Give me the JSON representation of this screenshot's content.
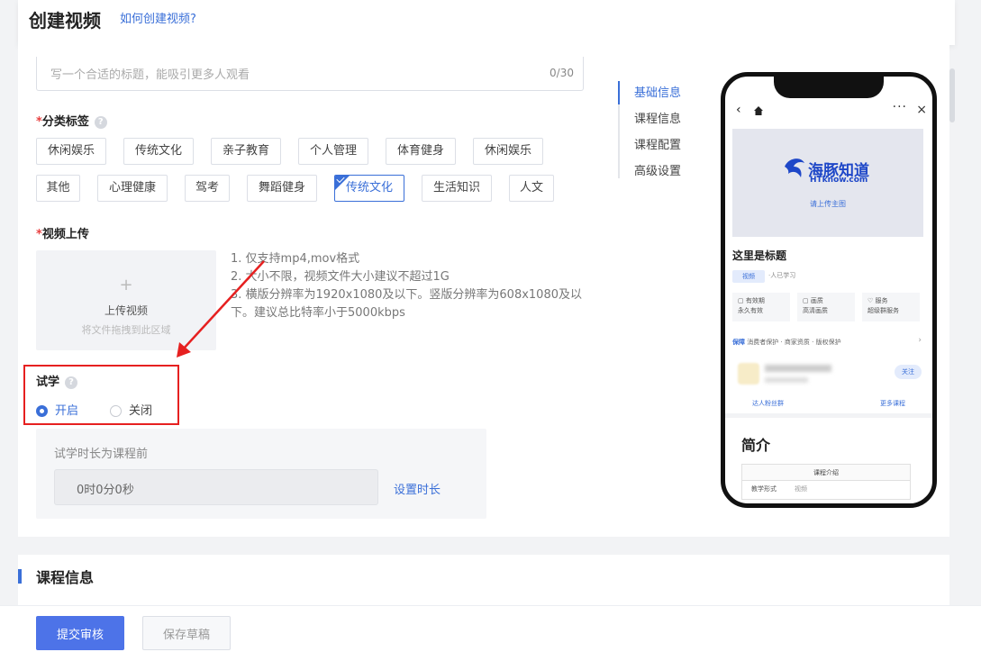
{
  "header": {
    "title": "创建视频",
    "help_link": "如何创建视频?"
  },
  "title_field": {
    "placeholder": "写一个合适的标题，能吸引更多人观看",
    "counter": "0/30"
  },
  "category": {
    "label": "分类标签",
    "required_mark": "*",
    "tags": [
      "休闲娱乐",
      "传统文化",
      "亲子教育",
      "个人管理",
      "体育健身",
      "休闲娱乐",
      "其他",
      "心理健康",
      "驾考",
      "舞蹈健身",
      "传统文化",
      "生活知识",
      "人文"
    ],
    "selected_index": 10
  },
  "video_upload": {
    "label": "视频上传",
    "required_mark": "*",
    "plus": "+",
    "button_text": "上传视频",
    "drag_hint": "将文件拖拽到此区域",
    "notes": [
      "1. 仅支持mp4,mov格式",
      "2. 大小不限，视频文件大小建议不超过1G",
      "3. 横版分辨率为1920x1080及以下。竖版分辨率为608x1080及以下。建议总比特率小于5000kbps"
    ]
  },
  "trial": {
    "label": "试学",
    "on_label": "开启",
    "off_label": "关闭",
    "selected": "on",
    "duration_label": "试学时长为课程前",
    "duration_value": "0时0分0秒",
    "set_duration_link": "设置时长"
  },
  "anchor_nav": {
    "items": [
      "基础信息",
      "课程信息",
      "课程配置",
      "高级设置"
    ],
    "active_index": 0
  },
  "preview": {
    "cover_brand_cn": "海豚知道",
    "cover_brand_en": "HTknow.com",
    "cover_hint": "请上传主图",
    "title": "这里是标题",
    "badge": "视频",
    "learners": "·人已学习",
    "features": [
      {
        "icon": "▢",
        "label": "有效期",
        "value": "永久有效"
      },
      {
        "icon": "▢",
        "label": "画质",
        "value": "高清画质"
      },
      {
        "icon": "♡",
        "label": "服务",
        "value": "超级群服务"
      }
    ],
    "guarantee_title": "保障",
    "guarantee_text": "消费者保护 · 商家资质 · 版权保护",
    "follow": "关注",
    "action_left": "达人粉丝群",
    "action_right": "更多课程",
    "intro_title": "简介",
    "table_header": "课程介绍",
    "table_row_label": "教学形式",
    "table_row_value": "视频"
  },
  "section2": {
    "title": "课程信息"
  },
  "footer": {
    "submit": "提交审核",
    "save_draft": "保存草稿"
  },
  "colors": {
    "accent": "#3a6fd8",
    "primary_button": "#4d73e8",
    "annotation_red": "#e62020"
  }
}
